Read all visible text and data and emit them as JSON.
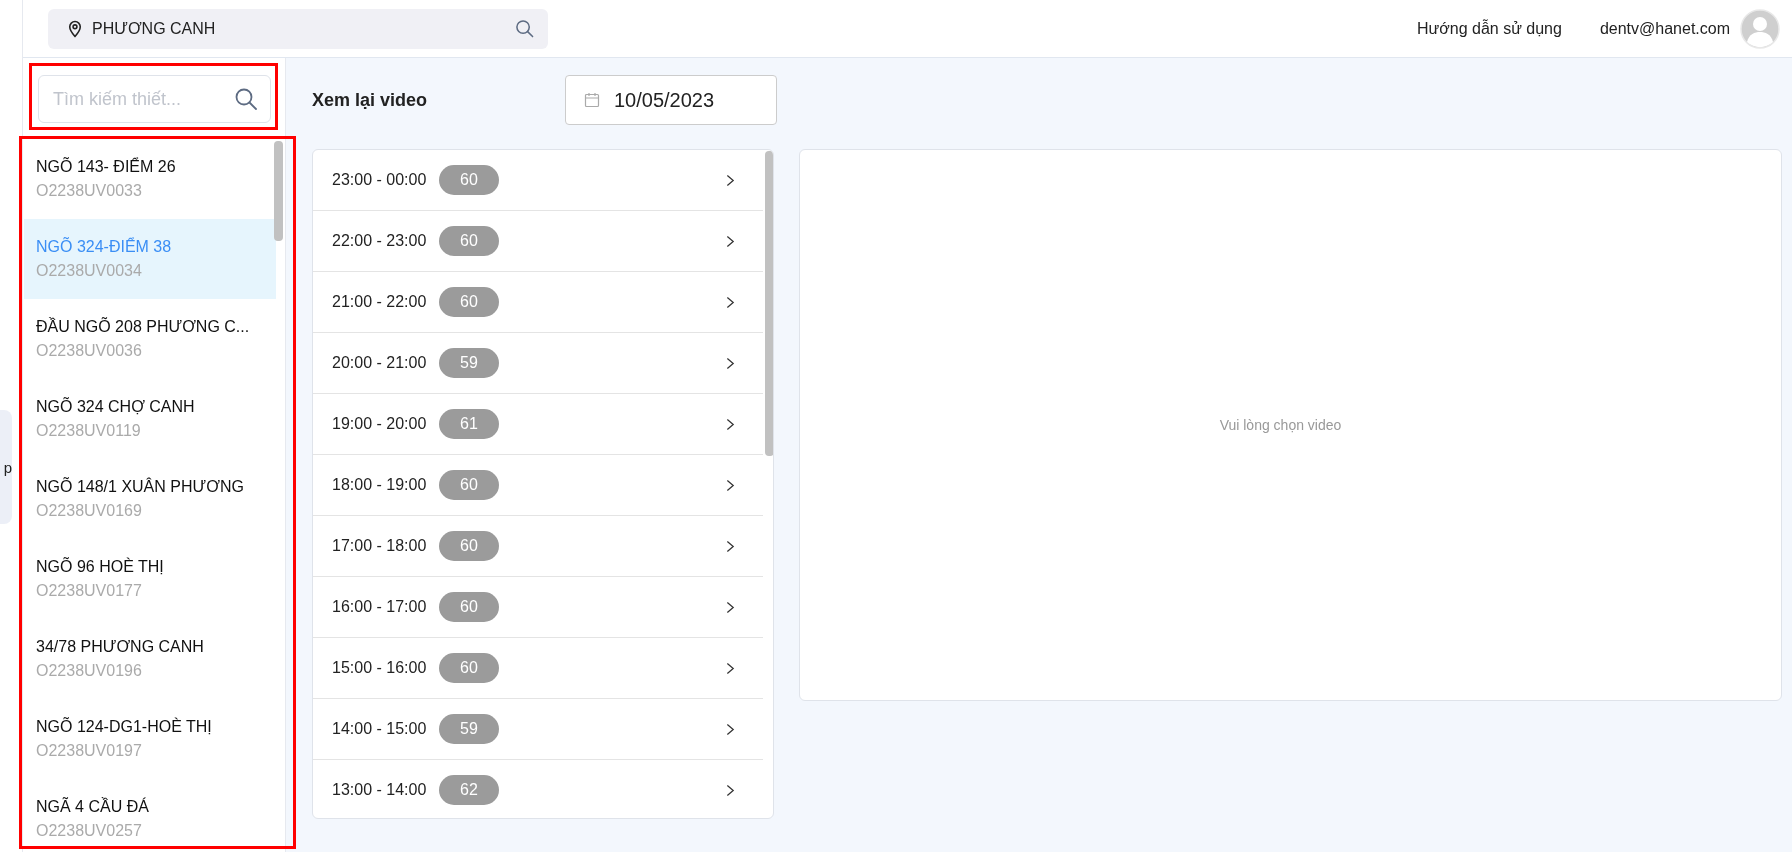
{
  "edge_tab": {
    "label": "p"
  },
  "top_bar": {
    "location_search": {
      "value": "PHƯƠNG CANH"
    },
    "help_link": "Hướng dẫn sử dụng",
    "user_email": "dentv@hanet.com"
  },
  "sidebar": {
    "search": {
      "placeholder": "Tìm kiếm thiết..."
    },
    "devices": [
      {
        "name": "NGÕ 143- ĐIỂM 26",
        "code": "O2238UV0033",
        "selected": false
      },
      {
        "name": "NGÕ 324-ĐIỂM 38",
        "code": "O2238UV0034",
        "selected": true
      },
      {
        "name": "ĐẦU NGÕ 208 PHƯƠNG C...",
        "code": "O2238UV0036",
        "selected": false
      },
      {
        "name": "NGÕ 324 CHỢ CANH",
        "code": "O2238UV0119",
        "selected": false
      },
      {
        "name": "NGÕ 148/1 XUÂN PHƯƠNG",
        "code": "O2238UV0169",
        "selected": false
      },
      {
        "name": "NGÕ 96 HOÈ THỊ",
        "code": "O2238UV0177",
        "selected": false
      },
      {
        "name": "34/78 PHƯƠNG CANH",
        "code": "O2238UV0196",
        "selected": false
      },
      {
        "name": "NGÕ 124-DG1-HOÈ THỊ",
        "code": "O2238UV0197",
        "selected": false
      },
      {
        "name": "NGÃ 4 CẦU ĐÁ",
        "code": "O2238UV0257",
        "selected": false
      }
    ]
  },
  "main": {
    "title": "Xem lại video",
    "date_field": {
      "value": "10/05/2023"
    },
    "hours": [
      {
        "range": "23:00 - 00:00",
        "count": "60"
      },
      {
        "range": "22:00 - 23:00",
        "count": "60"
      },
      {
        "range": "21:00 - 22:00",
        "count": "60"
      },
      {
        "range": "20:00 - 21:00",
        "count": "59"
      },
      {
        "range": "19:00 - 20:00",
        "count": "61"
      },
      {
        "range": "18:00 - 19:00",
        "count": "60"
      },
      {
        "range": "17:00 - 18:00",
        "count": "60"
      },
      {
        "range": "16:00 - 17:00",
        "count": "60"
      },
      {
        "range": "15:00 - 16:00",
        "count": "60"
      },
      {
        "range": "14:00 - 15:00",
        "count": "59"
      },
      {
        "range": "13:00 - 14:00",
        "count": "62"
      }
    ],
    "player": {
      "empty_message": "Vui lòng chọn video"
    }
  }
}
